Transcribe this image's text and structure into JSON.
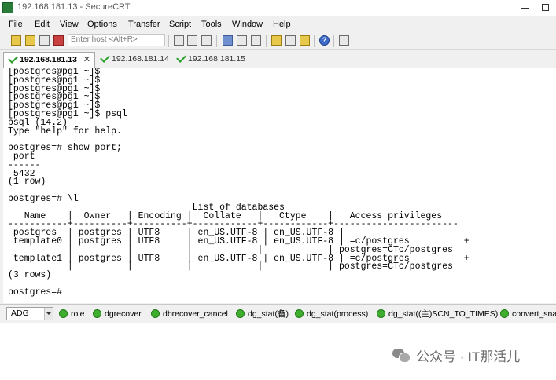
{
  "window": {
    "title": "192.168.181.13 - SecureCRT"
  },
  "menu": [
    "File",
    "Edit",
    "View",
    "Options",
    "Transfer",
    "Script",
    "Tools",
    "Window",
    "Help"
  ],
  "toolbar": {
    "host_placeholder": "Enter host <Alt+R>"
  },
  "tabs": [
    {
      "label": "192.168.181.13",
      "active": true
    },
    {
      "label": "192.168.181.14",
      "active": false
    },
    {
      "label": "192.168.181.15",
      "active": false
    }
  ],
  "terminal": {
    "lines": [
      "[postgres@pg1 ~]$",
      "[postgres@pg1 ~]$",
      "[postgres@pg1 ~]$",
      "[postgres@pg1 ~]$",
      "[postgres@pg1 ~]$",
      "[postgres@pg1 ~]$ psql",
      "psql (14.2)",
      "Type \"help\" for help.",
      "",
      "postgres=# show port;",
      " port",
      "------",
      " 5432",
      "(1 row)",
      "",
      "postgres=# \\l",
      "                                  List of databases",
      "   Name    |  Owner   | Encoding |  Collate   |   Ctype    |   Access privileges",
      "-----------+----------+----------+------------+------------+-----------------------",
      " postgres  | postgres | UTF8     | en_US.UTF-8 | en_US.UTF-8 |",
      " template0 | postgres | UTF8     | en_US.UTF-8 | en_US.UTF-8 | =c/postgres          +",
      "           |          |          |            |            | postgres=CTc/postgres",
      " template1 | postgres | UTF8     | en_US.UTF-8 | en_US.UTF-8 | =c/postgres          +",
      "           |          |          |            |            | postgres=CTc/postgres",
      "(3 rows)",
      "",
      "postgres=#"
    ]
  },
  "command_bar": {
    "session": "ADG",
    "buttons": [
      "role",
      "dgrecover",
      "dbrecover_cancel",
      "dg_stat(备)",
      "dg_stat(process)",
      "dg_stat((主)SCN_TO_TIMES)",
      "convert_sna"
    ]
  },
  "watermark": {
    "text": "公众号 · IT那活儿"
  }
}
